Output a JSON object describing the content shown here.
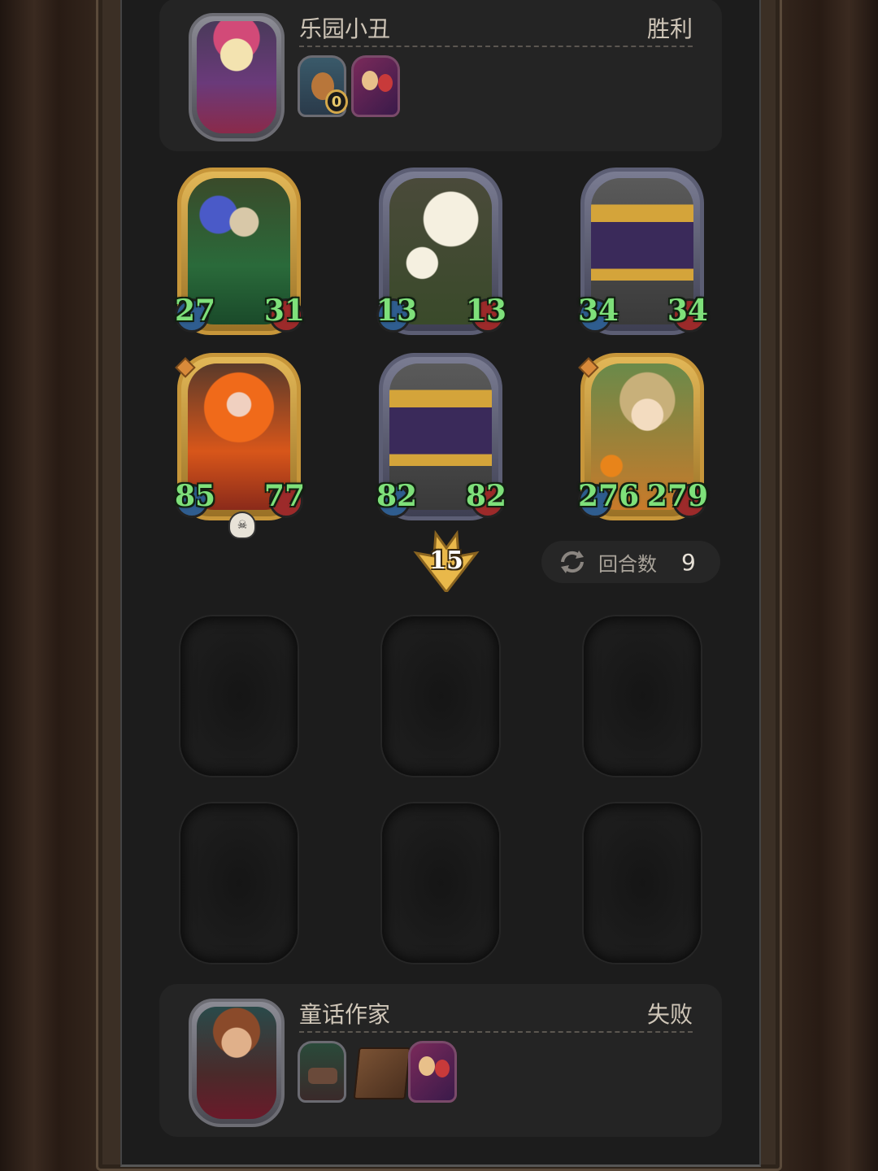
{
  "top_player": {
    "name": "乐园小丑",
    "result": "胜利",
    "portrait_icon": "clown-girl-portrait",
    "items": [
      {
        "icon": "squirrel-item",
        "badge": "0"
      },
      {
        "icon": "circus-card-item"
      }
    ]
  },
  "bottom_player": {
    "name": "童话作家",
    "result": "失败",
    "portrait_icon": "writer-portrait",
    "items": [
      {
        "icon": "forest-scene-item"
      },
      {
        "icon": "brown-book-item"
      },
      {
        "icon": "circus-card-item"
      }
    ]
  },
  "board": {
    "cards": [
      {
        "name": "lupine-dryad",
        "frame": "gold",
        "attack": "27",
        "health": "31"
      },
      {
        "name": "singing-daisies",
        "frame": "silver",
        "attack": "13",
        "health": "13"
      },
      {
        "name": "clockwork-book-walker",
        "frame": "silver",
        "attack": "34",
        "health": "34"
      },
      {
        "name": "flame-fairy",
        "frame": "gold",
        "attack": "85",
        "health": "77",
        "gem": true,
        "skull": true
      },
      {
        "name": "clockwork-book-walker",
        "frame": "silver",
        "attack": "82",
        "health": "82"
      },
      {
        "name": "orange-girl",
        "frame": "gold",
        "attack": "276",
        "health": "279",
        "gem": true
      }
    ],
    "level_badge": "15",
    "round_label": "回合数",
    "round_value": "9"
  },
  "colors": {
    "board_bg": "#1c1c1c",
    "stat_green": "#7ee07a",
    "gold_frame": "#c7963a",
    "silver_frame": "#5c5e74"
  }
}
